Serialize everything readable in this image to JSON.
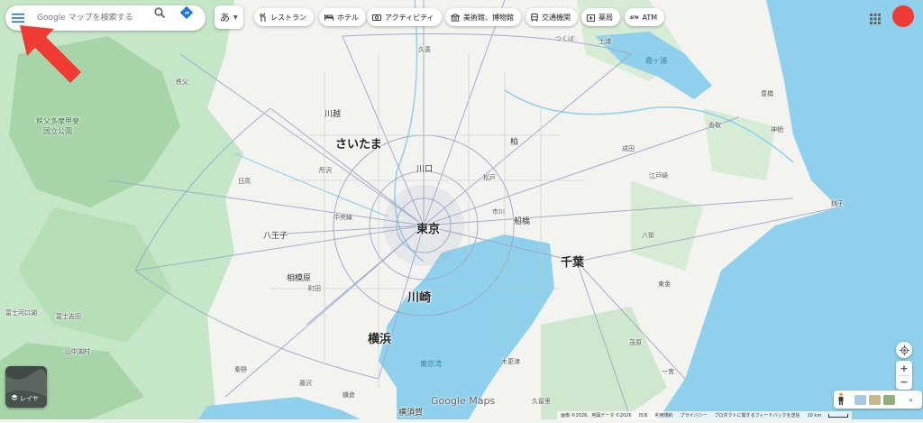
{
  "search": {
    "placeholder": "Google マップを検索する"
  },
  "ime": {
    "label": "あ"
  },
  "chips": [
    {
      "label": "レストラン",
      "icon": "restaurant-icon"
    },
    {
      "label": "ホテル",
      "icon": "hotel-icon"
    },
    {
      "label": "アクティビティ",
      "icon": "camera-icon"
    },
    {
      "label": "美術館、博物館",
      "icon": "museum-icon"
    },
    {
      "label": "交通機関",
      "icon": "transit-icon"
    },
    {
      "label": "薬局",
      "icon": "pharmacy-icon"
    },
    {
      "label": "ATM",
      "icon": "atm-icon"
    }
  ],
  "map": {
    "labels": [
      {
        "name": "さいたま",
        "class": "big"
      },
      {
        "name": "東京",
        "class": "big"
      },
      {
        "name": "千葉",
        "class": "big"
      },
      {
        "name": "川崎",
        "class": "big"
      },
      {
        "name": "横浜",
        "class": "big"
      },
      {
        "name": "川越",
        "class": "mid"
      },
      {
        "name": "川口",
        "class": "mid"
      },
      {
        "name": "柏",
        "class": "mid"
      },
      {
        "name": "船橋",
        "class": "mid"
      },
      {
        "name": "市川",
        "class": "small"
      },
      {
        "name": "八王子",
        "class": "mid"
      },
      {
        "name": "相模原",
        "class": "mid"
      },
      {
        "name": "所沢",
        "class": "small"
      },
      {
        "name": "中央線",
        "class": "small"
      },
      {
        "name": "町田",
        "class": "small"
      },
      {
        "name": "横須賀",
        "class": "mid"
      },
      {
        "name": "富士吉田",
        "class": "small"
      },
      {
        "name": "富士河口湖",
        "class": "small"
      },
      {
        "name": "山中湖村",
        "class": "small"
      },
      {
        "name": "秩父多摩甲斐\n国立公園",
        "class": "park"
      },
      {
        "name": "秩父",
        "class": "small"
      },
      {
        "name": "久喜",
        "class": "small"
      },
      {
        "name": "つくば",
        "class": "small"
      },
      {
        "name": "土浦",
        "class": "small"
      },
      {
        "name": "霞ヶ浦",
        "class": "sea"
      },
      {
        "name": "豊橋",
        "class": "small"
      },
      {
        "name": "香取",
        "class": "small"
      },
      {
        "name": "神栖",
        "class": "small"
      },
      {
        "name": "銚子",
        "class": "small"
      },
      {
        "name": "八街",
        "class": "small"
      },
      {
        "name": "東金",
        "class": "small"
      },
      {
        "name": "茂原",
        "class": "small"
      },
      {
        "name": "一宮",
        "class": "small"
      },
      {
        "name": "木更津",
        "class": "small"
      },
      {
        "name": "久留里",
        "class": "small"
      },
      {
        "name": "東京湾",
        "class": "sea"
      },
      {
        "name": "松戸",
        "class": "small"
      },
      {
        "name": "日高",
        "class": "small"
      },
      {
        "name": "藤沢",
        "class": "small"
      },
      {
        "name": "鎌倉",
        "class": "small"
      },
      {
        "name": "秦野",
        "class": "small"
      },
      {
        "name": "江戸崎",
        "class": "small"
      },
      {
        "name": "成田",
        "class": "small"
      }
    ]
  },
  "layers": {
    "label": "レイヤ"
  },
  "controls": {
    "zoom_in": "+",
    "zoom_out": "−"
  },
  "logo": "Google Maps",
  "footer": {
    "imagery": "画像 ©2026、地図データ ©2026",
    "country": "日本",
    "terms": "利用規約",
    "privacy": "プライバシー",
    "feedback": "プロダクトに関するフィードバックを送信",
    "scale": "10 km"
  },
  "colors": {
    "water": "#8fd1ec",
    "land": "#f3f3ef",
    "green": "#c5e6c7",
    "forest": "#a7d5a9",
    "road": "#9aa7c9",
    "accent": "#1a73e8",
    "arrow": "#f03b34"
  }
}
